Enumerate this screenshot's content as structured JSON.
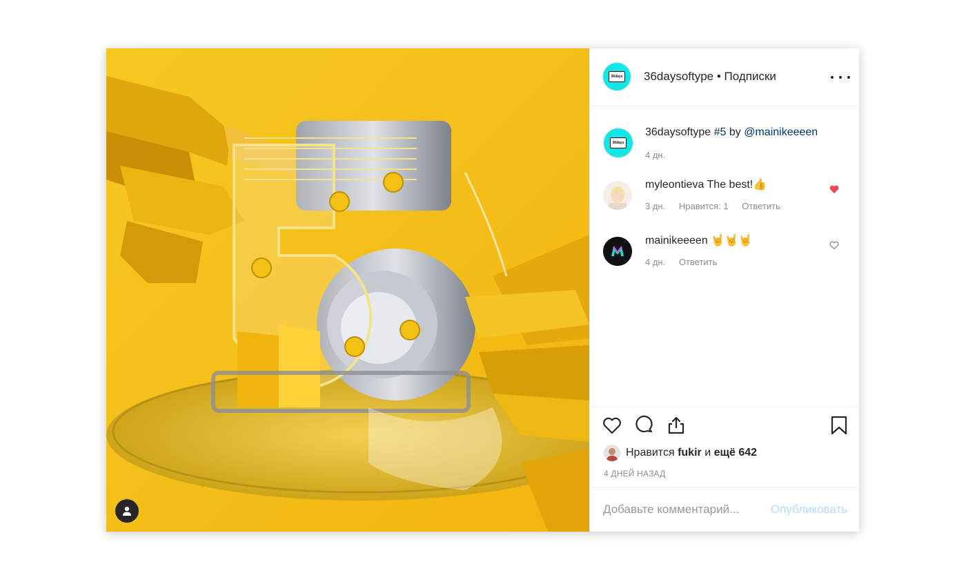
{
  "header": {
    "username": "36daysoftype",
    "separator": " • ",
    "follow_label": "Подписки",
    "avatar_text": "36days"
  },
  "comments": [
    {
      "username": "36daysoftype",
      "text_parts": [
        "#5",
        " by ",
        "@mainikeeeen"
      ],
      "time": "4 дн.",
      "avatar": "brand"
    },
    {
      "username": "myleontieva",
      "text": "The best!👍",
      "time": "3 дн.",
      "likes": "Нравится: 1",
      "reply": "Ответить",
      "liked": true
    },
    {
      "username": "mainikeeeen",
      "text": "🤘🤘🤘",
      "time": "4 дн.",
      "reply": "Ответить",
      "liked": false
    }
  ],
  "actions": {
    "likes_prefix": "Нравится",
    "liker": "fukir",
    "likes_mid": "и",
    "likes_more": "ещё 642",
    "timestamp": "4 ДНЕЙ НАЗАД"
  },
  "comment_box": {
    "placeholder": "Добавьте комментарий...",
    "publish": "Опубликовать"
  },
  "colors": {
    "brand_avatar": "#12e6e6",
    "liked_heart": "#ed4956",
    "link": "#003569",
    "publish_disabled": "#b3dbff",
    "media_bg": "#f5c51b"
  },
  "icons": [
    "heart-icon",
    "comment-icon",
    "share-icon",
    "bookmark-icon",
    "more-icon",
    "user-tag-icon"
  ]
}
